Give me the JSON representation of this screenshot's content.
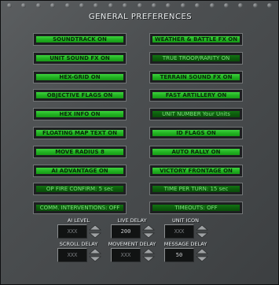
{
  "title": "GENERAL PREFERENCES",
  "left_buttons": [
    {
      "label": "SOUNDTRACK ON",
      "state": "on"
    },
    {
      "label": "UNIT SOUND FX ON",
      "state": "on"
    },
    {
      "label": "HEX-GRID ON",
      "state": "on"
    },
    {
      "label": "OBJECTIVE FLAGS ON",
      "state": "on"
    },
    {
      "label": "HEX INFO ON",
      "state": "on"
    },
    {
      "label": "FLOATING MAP TEXT ON",
      "state": "on"
    },
    {
      "label": "MOVE RADIUS 8",
      "state": "on"
    },
    {
      "label": "AI ADVANTAGE ON",
      "state": "on"
    },
    {
      "label": "OP FIRE CONFIRM: 5 sec",
      "state": "dark"
    },
    {
      "label": "COMM. INTERVENTIONS: OFF",
      "state": "dark"
    }
  ],
  "right_buttons": [
    {
      "label": "WEATHER & BATTLE FX ON",
      "state": "on"
    },
    {
      "label": "TRUE TROOP/RARITY ON",
      "state": "dark"
    },
    {
      "label": "TERRAIN SOUND FX ON",
      "state": "on"
    },
    {
      "label": "FAST ARTILLERY ON",
      "state": "on"
    },
    {
      "label": "UNIT NUMBER Your Units",
      "state": "dark"
    },
    {
      "label": "ID FLAGS ON",
      "state": "on"
    },
    {
      "label": "AUTO RALLY ON",
      "state": "on"
    },
    {
      "label": "VICTORY FRONTAGE ON",
      "state": "on"
    },
    {
      "label": "TIME PER TURN: 15 sec",
      "state": "dark"
    },
    {
      "label": "TIMEOUTS: OFF",
      "state": "dark"
    }
  ],
  "controls": [
    {
      "label": "AI LEVEL",
      "value": "XXX",
      "dim": true
    },
    {
      "label": "LIVE DELAY",
      "value": "200",
      "dim": false
    },
    {
      "label": "UNIT ICON",
      "value": "XXX",
      "dim": true
    },
    {
      "label": "SCROLL DELAY",
      "value": "XXX",
      "dim": true
    },
    {
      "label": "MOVEMENT DELAY",
      "value": "XXX",
      "dim": true
    },
    {
      "label": "MESSAGE DELAY",
      "value": "50",
      "dim": false
    }
  ],
  "icons": {
    "spin_up": "triangle-up-icon",
    "spin_down": "triangle-down-icon",
    "rivet": "rivet-icon"
  },
  "colors": {
    "button_on": "#22b322",
    "button_dark": "#0d5e0d",
    "panel": "#4c4f51"
  }
}
